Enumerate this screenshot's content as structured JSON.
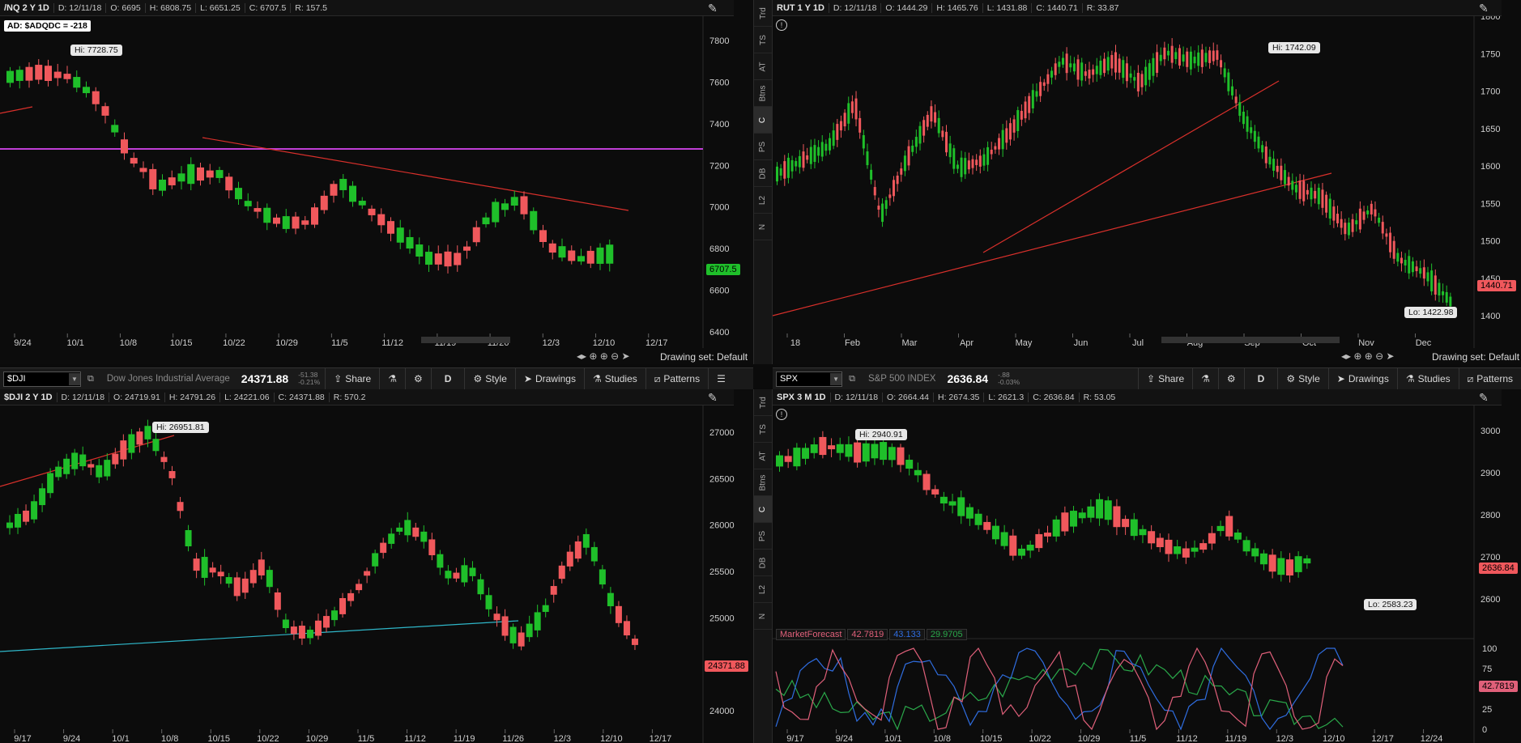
{
  "colors": {
    "up": "#1fbf2a",
    "down": "#f0585c",
    "trend": "#d9302b",
    "magenta": "#c03fd6",
    "cyan": "#2fb7c9",
    "blue": "#2f6de0",
    "pink": "#e0607a",
    "green": "#2aa84a"
  },
  "tl": {
    "header": {
      "symbol": "/NQ 2 Y 1D",
      "date": "D: 12/11/18",
      "open": "O: 6695",
      "high": "H: 6808.75",
      "low": "L: 6651.25",
      "close": "C: 6707.5",
      "range": "R: 157.5"
    },
    "ad_label": "AD: $ADQDC = -218",
    "hi_label": "Hi: 7728.75",
    "price_badge": "6707.5",
    "y_ticks": [
      "7800",
      "7600",
      "7400",
      "7200",
      "7000",
      "6800",
      "6600",
      "6400"
    ],
    "x_ticks": [
      "9/24",
      "10/1",
      "10/8",
      "10/15",
      "10/22",
      "10/29",
      "11/5",
      "11/12",
      "11/19",
      "11/26",
      "12/3",
      "12/10",
      "12/17"
    ],
    "drawing_set": "Drawing set: Default"
  },
  "tr": {
    "header": {
      "symbol": "RUT 1 Y 1D",
      "date": "D: 12/11/18",
      "open": "O: 1444.29",
      "high": "H: 1465.76",
      "low": "L: 1431.88",
      "close": "C: 1440.71",
      "range": "R: 33.87"
    },
    "hi_label": "Hi: 1742.09",
    "lo_label": "Lo: 1422.98",
    "price_badge": "1440.71",
    "y_ticks": [
      "1800",
      "1750",
      "1700",
      "1650",
      "1600",
      "1550",
      "1500",
      "1450",
      "1400"
    ],
    "x_ticks": [
      "18",
      "Feb",
      "Mar",
      "Apr",
      "May",
      "Jun",
      "Jul",
      "Aug",
      "Sep",
      "Oct",
      "Nov",
      "Dec"
    ],
    "drawing_set": "Drawing set: Default"
  },
  "toolbar_left": {
    "symbol": "$DJI",
    "description": "Dow Jones Industrial Average",
    "price": "24371.88",
    "change": "-51.38",
    "change_pct": "-0.21%",
    "share": "Share",
    "period": "D",
    "style": "Style",
    "drawings": "Drawings",
    "studies": "Studies",
    "patterns": "Patterns"
  },
  "toolbar_right": {
    "symbol": "SPX",
    "description": "S&P 500 INDEX",
    "price": "2636.84",
    "change": "-.88",
    "change_pct": "-0.03%",
    "share": "Share",
    "period": "D",
    "style": "Style",
    "drawings": "Drawings",
    "studies": "Studies",
    "patterns": "Patterns"
  },
  "bl": {
    "header": {
      "symbol": "$DJI 2 Y 1D",
      "date": "D: 12/11/18",
      "open": "O: 24719.91",
      "high": "H: 24791.26",
      "low": "L: 24221.06",
      "close": "C: 24371.88",
      "range": "R: 570.2"
    },
    "hi_label": "Hi: 26951.81",
    "price_badge": "24371.88",
    "y_ticks": [
      "27000",
      "26500",
      "26000",
      "25500",
      "25000",
      "24500",
      "24000"
    ],
    "x_ticks": [
      "9/17",
      "9/24",
      "10/1",
      "10/8",
      "10/15",
      "10/22",
      "10/29",
      "11/5",
      "11/12",
      "11/19",
      "11/26",
      "12/3",
      "12/10",
      "12/17"
    ]
  },
  "br": {
    "header": {
      "symbol": "SPX 3 M 1D",
      "date": "D: 12/11/18",
      "open": "O: 2664.44",
      "high": "H: 2674.35",
      "low": "L: 2621.3",
      "close": "C: 2636.84",
      "range": "R: 53.05"
    },
    "hi_label": "Hi: 2940.91",
    "lo_label": "Lo: 2583.23",
    "price_badge": "2636.84",
    "y_ticks": [
      "3000",
      "2900",
      "2800",
      "2700",
      "2600"
    ],
    "study": {
      "name": "MarketForecast",
      "v1": "42.7819",
      "v2": "43.133",
      "v3": "29.9705",
      "badge": "42.7819",
      "ticks": [
        "100",
        "75",
        "50",
        "25",
        "0"
      ]
    },
    "x_ticks": [
      "9/17",
      "9/24",
      "10/1",
      "10/8",
      "10/15",
      "10/22",
      "10/29",
      "11/5",
      "11/12",
      "11/19",
      "12/3",
      "12/10",
      "12/17",
      "12/24"
    ]
  },
  "side_tabs": [
    "Trd",
    "TS",
    "AT",
    "Btns",
    "C",
    "PS",
    "DB",
    "L2",
    "N"
  ]
}
